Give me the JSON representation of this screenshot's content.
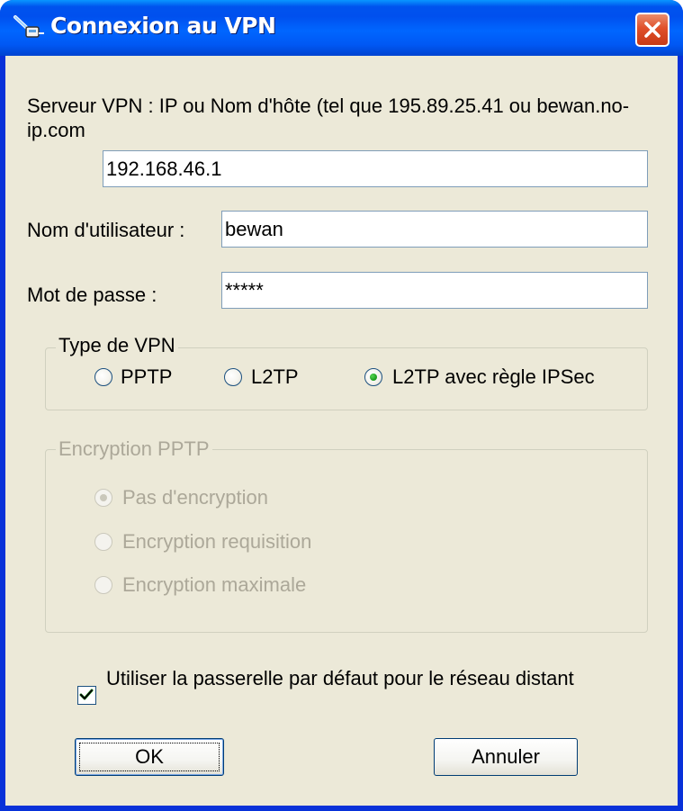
{
  "window": {
    "title": "Connexion au VPN",
    "colors": {
      "titlebar": "#0058f4",
      "client": "#ece9d8",
      "close": "#e0502a",
      "radio_dot": "#21a121"
    }
  },
  "server": {
    "label": "Serveur VPN : IP ou Nom d'hôte (tel que 195.89.25.41 ou bewan.no-ip.com",
    "value": "192.168.46.1"
  },
  "username": {
    "label": "Nom d'utilisateur :",
    "value": "bewan"
  },
  "password": {
    "label": "Mot de passe :",
    "value": "*****"
  },
  "vpn_type": {
    "legend": "Type de VPN",
    "options": [
      {
        "label": "PPTP",
        "selected": false
      },
      {
        "label": "L2TP",
        "selected": false
      },
      {
        "label": "L2TP avec règle IPSec",
        "selected": true
      }
    ]
  },
  "encryption": {
    "legend": "Encryption PPTP",
    "enabled": false,
    "options": [
      {
        "label": "Pas d'encryption",
        "selected": true
      },
      {
        "label": "Encryption requisition",
        "selected": false
      },
      {
        "label": "Encryption maximale",
        "selected": false
      }
    ]
  },
  "gateway": {
    "label": "Utiliser la passerelle par défaut pour le réseau distant",
    "checked": true
  },
  "buttons": {
    "ok": "OK",
    "cancel": "Annuler"
  }
}
